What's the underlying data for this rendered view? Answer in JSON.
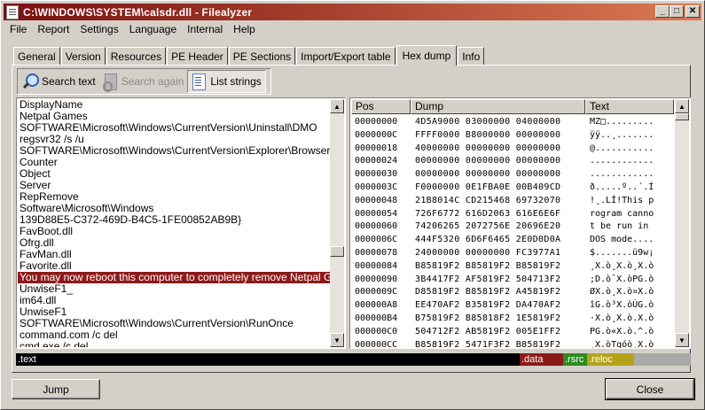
{
  "window": {
    "title": "C:\\WINDOWS\\SYSTEM\\calsdr.dll - Filealyzer",
    "minimize": "_",
    "maximize": "□",
    "close": "✕"
  },
  "menu": [
    "File",
    "Report",
    "Settings",
    "Language",
    "Internal",
    "Help"
  ],
  "tabs": [
    "General",
    "Version",
    "Resources",
    "PE Header",
    "PE Sections",
    "Import/Export table",
    "Hex dump",
    "Info"
  ],
  "active_tab": "Hex dump",
  "toolbar": {
    "search_text": "Search text",
    "search_again": "Search again",
    "list_strings": "List strings"
  },
  "strings": [
    "DisplayName",
    "Netpal Games",
    "SOFTWARE\\Microsoft\\Windows\\CurrentVersion\\Uninstall\\DMO",
    "regsvr32 /s /u",
    "SOFTWARE\\Microsoft\\Windows\\CurrentVersion\\Explorer\\Browser Helper",
    "Counter",
    "Object",
    "Server",
    "RepRemove",
    "Software\\Microsoft\\Windows",
    "139D88E5-C372-469D-B4C5-1FE00852AB9B}",
    "FavBoot.dll",
    "Ofrg.dll",
    "FavMan.dll",
    "Favorite.dll",
    "You may now reboot this computer to completely remove Netpal Games.",
    "UnwiseF1_",
    "im64.dll",
    "UnwiseF1",
    "SOFTWARE\\Microsoft\\Windows\\CurrentVersion\\RunOnce",
    "command.com /c del",
    "cmd.exe /c del"
  ],
  "selected_string_index": 15,
  "hex": {
    "columns": [
      "Pos",
      "Dump",
      "Text"
    ],
    "rows": [
      {
        "pos": "00000000",
        "dump": "4D5A9000 03000000 04000000",
        "text": "MZ□........."
      },
      {
        "pos": "0000000C",
        "dump": "FFFF0000 B8000000 00000000",
        "text": "ÿÿ..¸......."
      },
      {
        "pos": "00000018",
        "dump": "40000000 00000000 00000000",
        "text": "@..........."
      },
      {
        "pos": "00000024",
        "dump": "00000000 00000000 00000000",
        "text": "............"
      },
      {
        "pos": "00000030",
        "dump": "00000000 00000000 00000000",
        "text": "............"
      },
      {
        "pos": "0000003C",
        "dump": "F0000000 0E1FBA0E 00B409CD",
        "text": "ð.....º..´.Í"
      },
      {
        "pos": "00000048",
        "dump": "21B8014C CD215468 69732070",
        "text": "!¸.LÍ!This p"
      },
      {
        "pos": "00000054",
        "dump": "726F6772 616D2063 616E6E6F",
        "text": "rogram canno"
      },
      {
        "pos": "00000060",
        "dump": "74206265 2072756E 20696E20",
        "text": "t be run in "
      },
      {
        "pos": "0000006C",
        "dump": "444F5320 6D6F6465 2E0D0D0A",
        "text": "DOS mode...."
      },
      {
        "pos": "00000078",
        "dump": "24000000 00000000 FC3977A1",
        "text": "$.......ü9w¡"
      },
      {
        "pos": "00000084",
        "dump": "B85819F2 B85819F2 B85819F2",
        "text": "¸X.ò¸X.ò¸X.ò"
      },
      {
        "pos": "00000090",
        "dump": "3B4417F2 AF5819F2 504713F2",
        "text": ";D.ò¯X.òPG.ò"
      },
      {
        "pos": "0000009C",
        "dump": "D85819F2 B85819F2 A45819F2",
        "text": "ØX.ò¸X.ò¤X.ò"
      },
      {
        "pos": "000000A8",
        "dump": "EE470AF2 B35819F2 DA470AF2",
        "text": "îG.ò³X.òÚG.ò"
      },
      {
        "pos": "000000B4",
        "dump": "B75819F2 B85818F2 1E5819F2",
        "text": "·X.ò¸X.ò.X.ò"
      },
      {
        "pos": "000000C0",
        "dump": "504712F2 AB5819F2 005E1FF2",
        "text": "PG.ò«X.ò.^.ò"
      },
      {
        "pos": "000000CC",
        "dump": "B85819F2 5471F3F2 B85819F2",
        "text": "¸X.òTqóò¸X.ò"
      }
    ]
  },
  "sections": [
    {
      "label": ".text",
      "color": "#000000",
      "text_color": "#ffffff"
    },
    {
      "label": ".data",
      "color": "#8b1a1a",
      "text_color": "#ffffff"
    },
    {
      "label": ".rsrc",
      "color": "#2e8b22",
      "text_color": "#ffffff"
    },
    {
      "label": ".reloc",
      "color": "#b5a21a",
      "text_color": "#ffffff"
    },
    {
      "label": "",
      "color": "#a9a9a9",
      "text_color": "#ffffff"
    }
  ],
  "buttons": {
    "jump": "Jump",
    "close": "Close"
  }
}
